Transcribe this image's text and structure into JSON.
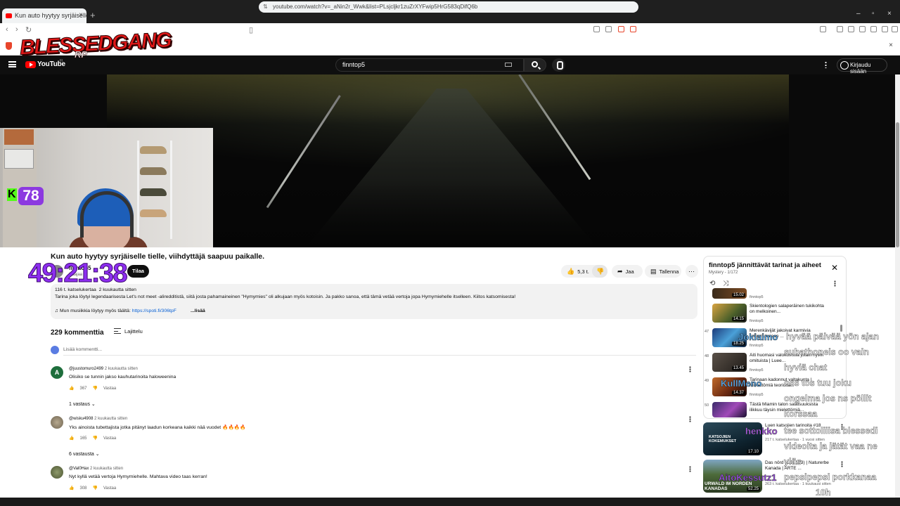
{
  "browser": {
    "tab_title": "Kun auto hyytyy syrjäiselle tielle",
    "url": "youtube.com/watch?v=_aNin2r_Wwk&list=PLsjcljkr1zuZrXYFwip5HrG583qDifQ6b"
  },
  "overlay": {
    "brand": "BLESSEDGANG",
    "brand_sub": "RP",
    "viewer_count": "78",
    "timer": "49:21:38"
  },
  "masthead": {
    "logo_text": "YouTube",
    "region": "FI",
    "search_value": "finntop5",
    "signin_label": "Kirjaudu sisään"
  },
  "video": {
    "title": "Kun auto hyytyy syrjäiselle tielle, viihdyttäjä saapuu paikalle.",
    "channel": "finntop5",
    "subscribers": "tilaajaa",
    "subscribe_label": "Tilaa",
    "likes": "5,3 t.",
    "share_label": "Jaa",
    "save_label": "Tallenna",
    "views": "116 t. katselukertaa",
    "age": "2 kuukautta sitten",
    "description": "Tarina joka löytyi legendaarisesta Let's not meet -aliredditistä, siitä josta pahamaineinen \"Hymymies\" oli alkujaan myös kotoisin. Ja pakko sanoa, että tämä vetää vertoja jopa Hymymiehelle itselleen. Kiitos katsomisesta!",
    "music_text": "Mun musiikkia löytyy myös täältä:",
    "music_link": "https://spoti.fi/306tpF",
    "more_label": "...lisää"
  },
  "comments": {
    "count": "229 kommenttia",
    "sort_label": "Lajittelu",
    "add_placeholder": "Lisää kommentti...",
    "reply_label": "Vastaa",
    "items": [
      {
        "author": "@juustomuro2499",
        "age": "2 kuukautta sitten",
        "text": "Olisiko se tunnin jakso kauhutarinoita haloweenina",
        "likes": "367",
        "replies": "1 vastaus",
        "initial": "A"
      },
      {
        "author": "@wisku4908",
        "age": "2 kuukautta sitten",
        "text": "Yks ainoista tubettajista jotka pitänyt laadun korkeana kaikki nää vuodet 🔥🔥🔥🔥",
        "likes": "165",
        "replies": "6 vastausta",
        "initial": ""
      },
      {
        "author": "@Val0Hax",
        "age": "2 kuukautta sitten",
        "text": "Nyt kyllä vetää vertoja Hymymiehelle. Mahtava video taas kerran!",
        "likes": "308",
        "replies": "",
        "initial": ""
      }
    ]
  },
  "playlist": {
    "title": "finntop5 jännittävät tarinat ja aiheet",
    "subtitle": "Mystery - 1/172",
    "items": [
      {
        "num": "",
        "title": "",
        "channel": "finntop5",
        "duration": "15.02"
      },
      {
        "num": "",
        "title": "Skientologien salaperäinen tukikohta on melkoinen...",
        "channel": "finntop5",
        "duration": "14.15"
      },
      {
        "num": "47",
        "title": "Merenkävijät jakoivat karmivia kokemuksiaan ...",
        "channel": "finntop5",
        "duration": "18.25"
      },
      {
        "num": "48",
        "title": "Äiti huomasi valokuvissa jotain hyvin omituista | Luee...",
        "channel": "finntop5",
        "duration": "13.45"
      },
      {
        "num": "49",
        "title": "Tarinaan kadonnut valtakunta | Mielettömiä teorioita...",
        "channel": "finntop5",
        "duration": "14.37"
      },
      {
        "num": "50",
        "title": "Tästä Miamin talon salaisuuksista ilikkuu täysin mielettömiä...",
        "channel": "",
        "duration": ""
      }
    ]
  },
  "recommendations": [
    {
      "title": "Luen katsojien tarinoita #18",
      "meta": "217 t. katselukertaa · 1 vuosi sitten",
      "duration": "17.10",
      "thumb_label": "KATSOJIEN KOKEMUKSET"
    },
    {
      "title": "Das nörd (1/3) (2/3) | Naturerbe Kanada | ARTE ...",
      "meta": "263 t. katselukertaa · 1 kuukausi sitten",
      "duration": "52.25",
      "thumb_label": "URWALD IM NORDEN KANADAS"
    }
  ],
  "chat": [
    {
      "user": "Jokiaimo",
      "user_color": "#5fb8ff",
      "message": "hyvää päivää yön ajan"
    },
    {
      "user": "",
      "user_color": "",
      "message": "subathoneis oo vain"
    },
    {
      "user": "",
      "user_color": "",
      "message": "hyviä chat"
    },
    {
      "user": "KullMeno",
      "user_color": "#5fb8ff",
      "message": "oss tos tuu joku"
    },
    {
      "user": "",
      "user_color": "",
      "message": "ongelma jos ns pöllit"
    },
    {
      "user": "",
      "user_color": "",
      "message": "korssaa"
    },
    {
      "user": "henkko",
      "user_color": "#c066ff",
      "message": "tee sottoliiisa blessedi"
    },
    {
      "user": "",
      "user_color": "",
      "message": "videoita ja jätät vaa ne"
    },
    {
      "user": "",
      "user_color": "",
      "message": "ylös"
    },
    {
      "user": "AitoKessutz1",
      "user_color": "#a855f7",
      "message": "pepsipepsi porkkanaa"
    },
    {
      "user": "",
      "user_color": "",
      "message": "10h"
    }
  ],
  "colors": {
    "youtube_red": "#ff0000",
    "kick_green": "#53fc18",
    "timer_purple": "#8d2ef0",
    "link_blue": "#065fd4"
  }
}
